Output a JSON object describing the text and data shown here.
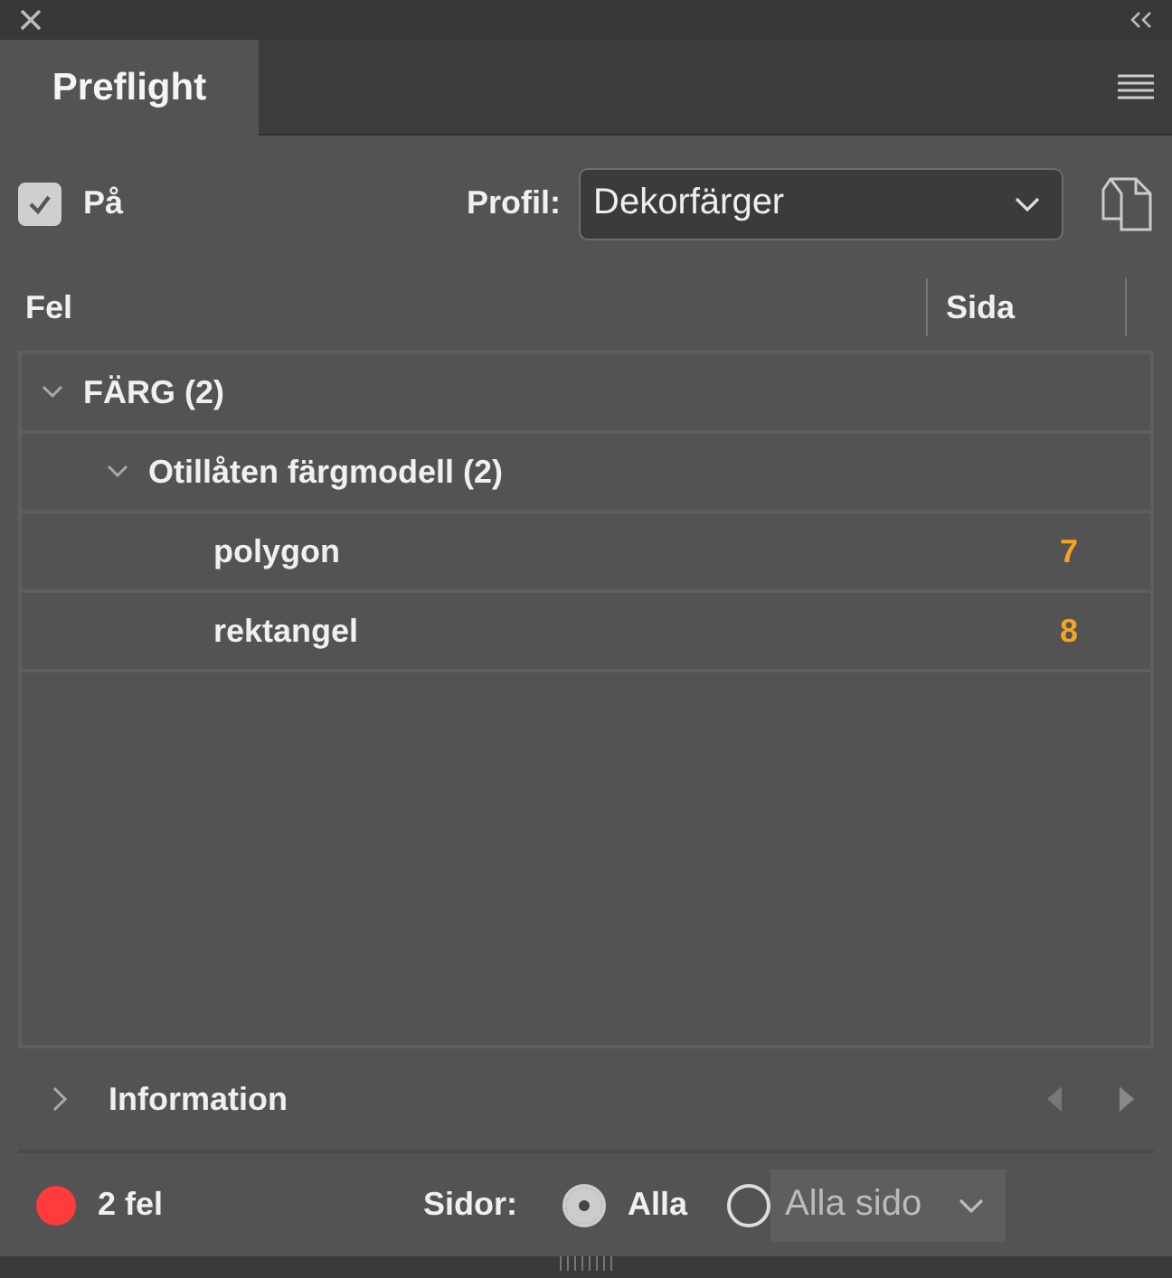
{
  "tab": {
    "label": "Preflight",
    "selected": true
  },
  "enabled": {
    "label": "På",
    "checked": true
  },
  "profile": {
    "label": "Profil:",
    "value": "Dekorfärger"
  },
  "columns": [
    "Fel",
    "Sida"
  ],
  "tree": [
    {
      "label": "FÄRG (2)",
      "expanded": true,
      "children": [
        {
          "label": "Otillåten färgmodell (2)",
          "expanded": true,
          "children": [
            {
              "label": "polygon",
              "page": "7"
            },
            {
              "label": "rektangel",
              "page": "8"
            }
          ]
        }
      ]
    }
  ],
  "info": {
    "label": "Information",
    "expanded": false
  },
  "status": {
    "color": "#ff3b3b",
    "text": "2 fel"
  },
  "pages": {
    "label": "Sidor:",
    "options": [
      {
        "kind": "radio",
        "label": "Alla",
        "selected": true
      },
      {
        "kind": "dropdown",
        "value": "Alla sido",
        "selected": false
      }
    ]
  }
}
